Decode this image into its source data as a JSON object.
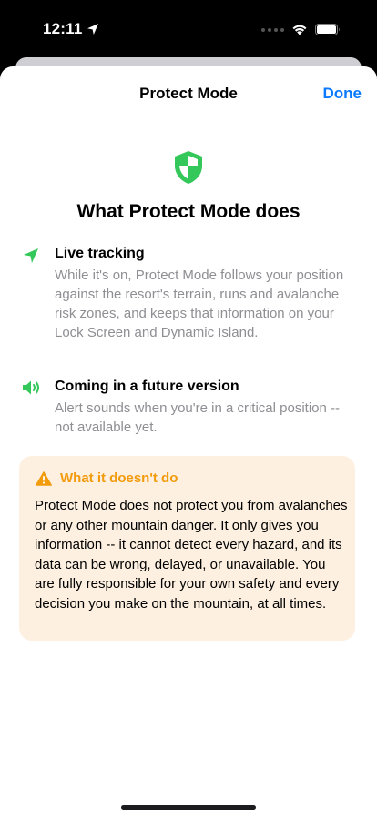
{
  "status_bar": {
    "time": "12:11",
    "location_icon": "location-arrow-icon",
    "signal_icon": "cellular-signal-icon",
    "wifi_icon": "wifi-icon",
    "battery_icon": "battery-icon"
  },
  "nav": {
    "title": "Protect Mode",
    "done_label": "Done"
  },
  "hero": {
    "icon": "shield-icon",
    "title": "What Protect Mode does",
    "accent_color": "#34c759"
  },
  "features": [
    {
      "icon": "location-arrow-icon",
      "title": "Live tracking",
      "description": "While it's on, Protect Mode follows your position against the resort's terrain, runs and avalanche risk zones, and keeps that information on your Lock Screen and Dynamic Island."
    },
    {
      "icon": "speaker-wave-icon",
      "title": "Coming in a future version",
      "description": "Alert sounds when you're in a critical position -- not available yet."
    }
  ],
  "warning": {
    "icon": "warning-triangle-icon",
    "title": "What it doesn't do",
    "body": "Protect Mode does not protect you from avalanches or any other mountain danger. It only gives you information -- it cannot detect every hazard, and its data can be wrong, delayed, or unavailable. You are fully responsible for your own safety and every decision you make on the mountain, at all times.",
    "accent_color": "#f29b0c",
    "background_color": "#fdf0e1"
  },
  "colors": {
    "link_blue": "#0a7aff",
    "secondary_text": "#8e8e93"
  }
}
